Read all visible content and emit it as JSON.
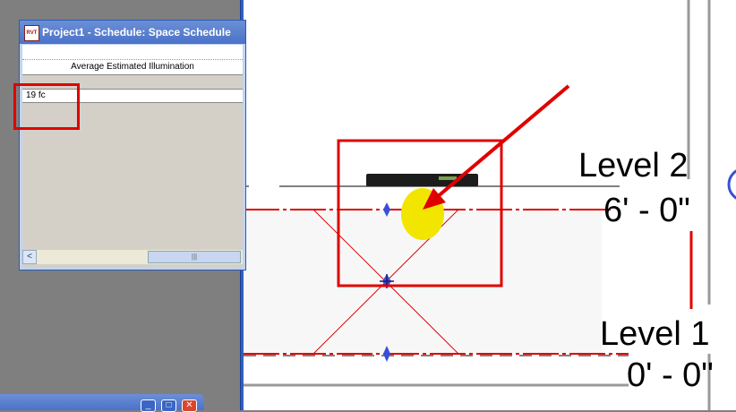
{
  "schedule_window": {
    "title": "Project1 - Schedule: Space Schedule",
    "app_icon": "RVT",
    "column_header": "Average Estimated Illumination",
    "row_value": "19 fc",
    "scroll_left": "<",
    "scroll_grip": "|||"
  },
  "minimized_window": {
    "minimize": "_",
    "restore": "□",
    "close": "✕"
  },
  "levels": {
    "level2_name": "Level 2",
    "level2_elevation": "6' - 0\"",
    "level1_name": "Level 1",
    "level1_elevation": "0' - 0\""
  },
  "colors": {
    "highlight_red": "#e00000",
    "light_fixture_yellow": "#f2e600",
    "grip_blue": "#3a4fd8"
  }
}
